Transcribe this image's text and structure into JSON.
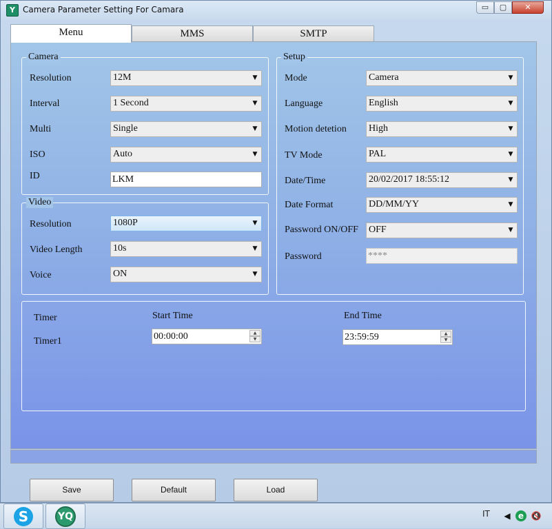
{
  "window": {
    "title": "Camera Parameter Setting For  Camara",
    "icon": "app-logo-icon"
  },
  "window_controls": {
    "minimize": "▭",
    "maximize": "▢",
    "close": "✕"
  },
  "tabs": [
    {
      "label": "Menu",
      "active": true
    },
    {
      "label": "MMS",
      "active": false
    },
    {
      "label": "SMTP",
      "active": false
    }
  ],
  "camera": {
    "legend": "Camera",
    "resolution_label": "Resolution",
    "resolution_value": "12M",
    "interval_label": "Interval",
    "interval_value": "1 Second",
    "multi_label": "Multi",
    "multi_value": "Single",
    "iso_label": "ISO",
    "iso_value": "Auto",
    "id_label": "ID",
    "id_value": "LKM"
  },
  "video": {
    "legend": "Video",
    "resolution_label": "Resolution",
    "resolution_value": "1080P",
    "length_label": "Video Length",
    "length_value": "10s",
    "voice_label": "Voice",
    "voice_value": "ON"
  },
  "setup": {
    "legend": "Setup",
    "mode_label": "Mode",
    "mode_value": "Camera",
    "language_label": "Language",
    "language_value": "English",
    "motion_label": "Motion detetion",
    "motion_value": "High",
    "tvmode_label": "TV Mode",
    "tvmode_value": "PAL",
    "datetime_label": "Date/Time",
    "datetime_value": "20/02/2017 18:55:12",
    "dateformat_label": "Date Format",
    "dateformat_value": "DD/MM/YY",
    "password_onoff_label": "Password ON/OFF",
    "password_onoff_value": "OFF",
    "password_label": "Password",
    "password_value": "****"
  },
  "timer": {
    "header_label": "Timer",
    "start_header": "Start Time",
    "end_header": "End Time",
    "rows": [
      {
        "name": "Timer1",
        "start": "00:00:00",
        "end": "23:59:59"
      }
    ]
  },
  "buttons": {
    "save": "Save",
    "default": "Default",
    "load": "Load"
  },
  "dropdown_arrow": "▼",
  "taskbar": {
    "language": "IT",
    "apps": [
      "skype-icon",
      "app-logo-icon"
    ]
  },
  "colors": {
    "panel_top": "#a2c6e8",
    "panel_bottom": "#7a93e8",
    "close_button": "#c8412e"
  }
}
